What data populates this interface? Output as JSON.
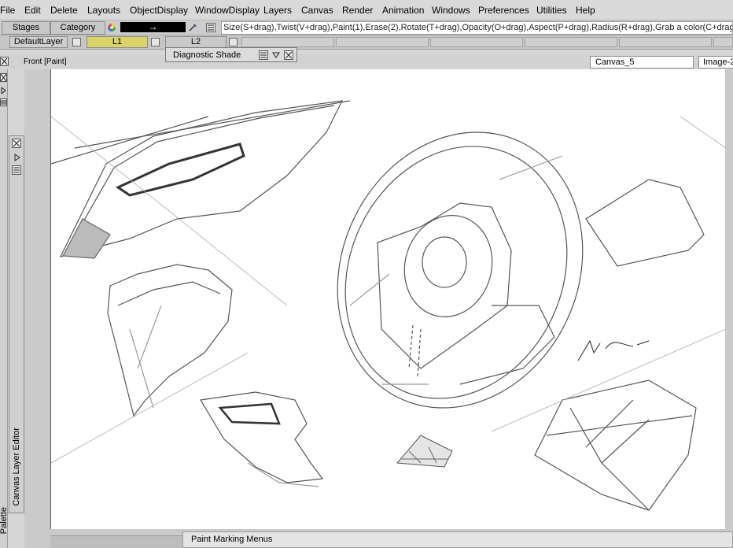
{
  "menubar": {
    "items": [
      "File",
      "Edit",
      "Delete",
      "Layouts",
      "ObjectDisplay",
      "WindowDisplay",
      "Layers",
      "Canvas",
      "Render",
      "Animation",
      "Windows",
      "Preferences",
      "Utilities",
      "Help"
    ]
  },
  "shelf": {
    "stages": "Stages",
    "category": "Category",
    "arrow": "→",
    "hint": "Size(S+drag),Twist(V+drag),Paint(1),Erase(2),Rotate(T+drag),Opacity(O+drag),Aspect(P+drag),Radius(R+drag),Grab a color(C+drag"
  },
  "layers": {
    "default": "DefaultLayer",
    "l1": "L1",
    "l2": "L2"
  },
  "diagnostic": {
    "title": "Diagnostic Shade"
  },
  "view": {
    "label": "Front [Paint]",
    "canvas_name": "Canvas_5",
    "image_name": "Image-2"
  },
  "panels": {
    "layer_editor": "Canvas Layer Editor",
    "palette": "Palette",
    "marking_menus": "Paint Marking Menus"
  },
  "colors": {
    "l1_fill": "#d9d36a",
    "accent": "#000000"
  }
}
